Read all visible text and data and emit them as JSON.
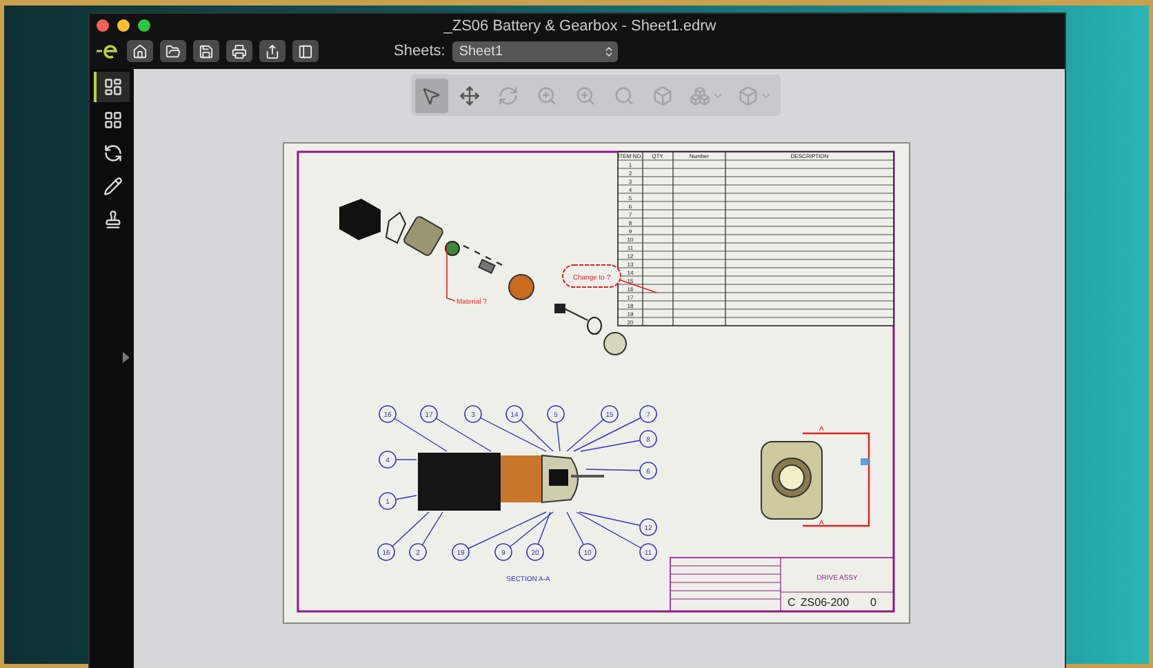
{
  "window": {
    "title": "_ZS06 Battery & Gearbox - Sheet1.edrw"
  },
  "toolbar": {
    "sheets_label": "Sheets:",
    "sheet_select": {
      "value": "Sheet1"
    }
  },
  "sidebar": {
    "items": [
      {
        "selected": true
      },
      {
        "selected": false
      },
      {
        "selected": false
      },
      {
        "selected": false
      },
      {
        "selected": false
      }
    ]
  },
  "view_toolbar": {
    "tools": [
      {
        "selected": true,
        "disabled": false
      },
      {
        "selected": false,
        "disabled": false
      },
      {
        "selected": false,
        "disabled": true
      },
      {
        "selected": false,
        "disabled": true
      },
      {
        "selected": false,
        "disabled": true
      },
      {
        "selected": false,
        "disabled": true
      },
      {
        "selected": false,
        "disabled": true
      },
      {
        "selected": false,
        "disabled": true
      },
      {
        "selected": false,
        "disabled": true
      }
    ]
  },
  "drawing": {
    "cloud_note": "Change to ?",
    "leader_note": "Material ?",
    "view_label": "SECTION A-A",
    "section_marks": [
      "A",
      "A"
    ],
    "balloons": [
      {
        "label": "16"
      },
      {
        "label": "17"
      },
      {
        "label": "3"
      },
      {
        "label": "14"
      },
      {
        "label": "5"
      },
      {
        "label": "15"
      },
      {
        "label": "7"
      },
      {
        "label": "8"
      },
      {
        "label": "4"
      },
      {
        "label": "6"
      },
      {
        "label": "1"
      },
      {
        "label": "12"
      },
      {
        "label": "16"
      },
      {
        "label": "2"
      },
      {
        "label": "19"
      },
      {
        "label": "9"
      },
      {
        "label": "20"
      },
      {
        "label": "10"
      },
      {
        "label": "11"
      }
    ],
    "bom": {
      "columns": [
        "ITEM NO.",
        "QTY.",
        "Number",
        "DESCRIPTION"
      ],
      "rows": [
        {
          "item": "1"
        },
        {
          "item": "2"
        },
        {
          "item": "3"
        },
        {
          "item": "4"
        },
        {
          "item": "5"
        },
        {
          "item": "6"
        },
        {
          "item": "7"
        },
        {
          "item": "8"
        },
        {
          "item": "9"
        },
        {
          "item": "10"
        },
        {
          "item": "11"
        },
        {
          "item": "12"
        },
        {
          "item": "13"
        },
        {
          "item": "14"
        },
        {
          "item": "15"
        },
        {
          "item": "16"
        },
        {
          "item": "17"
        },
        {
          "item": "18"
        },
        {
          "item": "19"
        },
        {
          "item": "20"
        }
      ]
    },
    "title_block": {
      "title": "DRIVE ASSY",
      "size": "C",
      "drawing_number": "ZS06-200",
      "revision": "0"
    }
  }
}
